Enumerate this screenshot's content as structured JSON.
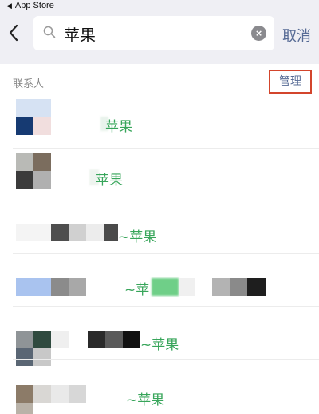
{
  "status_bar": {
    "back_app": "App Store"
  },
  "search": {
    "query": "苹果",
    "cancel_label": "取消"
  },
  "section": {
    "label": "联系人",
    "manage_label": "管理"
  },
  "contacts": [
    {
      "name": "苹果"
    },
    {
      "name": "苹果"
    },
    {
      "name": "~苹果"
    },
    {
      "name": "~苹"
    },
    {
      "name": "~苹果"
    },
    {
      "name": "~苹果"
    }
  ],
  "colors": {
    "accent": "#576b95",
    "match_highlight": "#37a55a",
    "manage_border": "#d3452c"
  },
  "icons": {
    "back": "chevron-left-icon",
    "search": "search-icon",
    "clear": "clear-icon"
  }
}
